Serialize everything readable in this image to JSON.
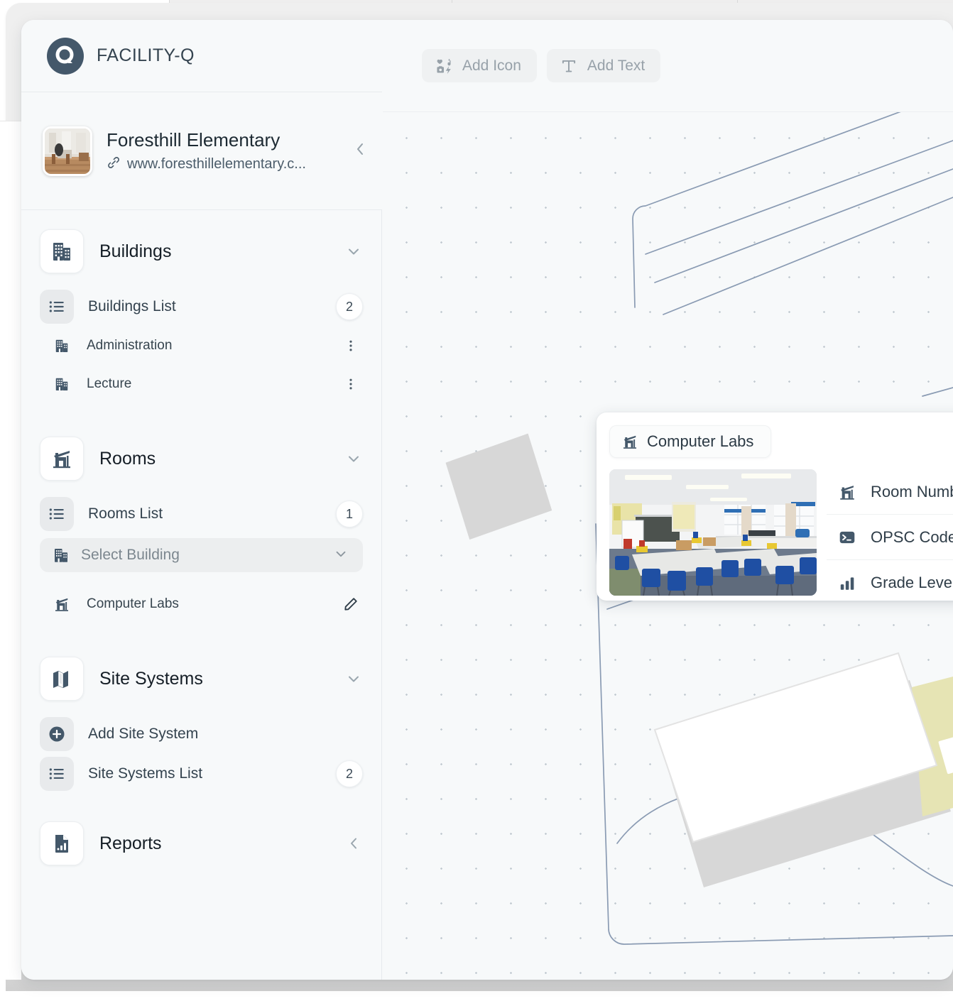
{
  "app": {
    "brand_name": "FACILITY-Q",
    "logo_icon": "circle-q-logo-icon",
    "accent_dark": "#44586a",
    "panel_bg": "#f7f9fa"
  },
  "site_card": {
    "thumbnail_icon": "site-interior-photo",
    "title": "Foresthill Elementary",
    "link_icon": "link-icon",
    "url": "www.foresthillelementary.c...",
    "collapse_icon": "chevron-left-icon"
  },
  "sidebar": {
    "groups": [
      {
        "id": "buildings",
        "label": "Buildings",
        "icon": "office-buildings-icon",
        "toggle_icon": "chevron-down-icon",
        "rows": [
          {
            "label": "Buildings List",
            "icon": "list-icon",
            "count": "2",
            "tile_filled": true
          },
          {
            "label": "Administration",
            "icon": "building-icon",
            "action_icon": "kebab-menu-icon"
          },
          {
            "label": "Lecture",
            "icon": "building-icon",
            "action_icon": "kebab-menu-icon"
          }
        ]
      },
      {
        "id": "rooms",
        "label": "Rooms",
        "icon": "house-icon",
        "toggle_icon": "chevron-down-icon",
        "rows": [
          {
            "label": "Rooms List",
            "icon": "list-icon",
            "count": "1",
            "tile_filled": true
          },
          {
            "label": "Computer Labs",
            "icon": "house-icon",
            "action_icon": "pencil-edit-icon"
          }
        ],
        "select": {
          "icon": "building-icon",
          "placeholder": "Select Building",
          "caret_icon": "chevron-down-icon"
        }
      },
      {
        "id": "site-systems",
        "label": "Site Systems",
        "icon": "map-icon",
        "toggle_icon": "chevron-down-icon",
        "rows": [
          {
            "label": "Add Site System",
            "icon": "plus-circle-icon",
            "tile_filled": true
          },
          {
            "label": "Site Systems List",
            "icon": "list-icon",
            "count": "2",
            "tile_filled": true
          }
        ]
      },
      {
        "id": "reports",
        "label": "Reports",
        "icon": "report-document-icon",
        "toggle_icon": "chevron-left-icon",
        "rows": []
      }
    ]
  },
  "toolbar": {
    "buttons": [
      {
        "label": "Add Icon",
        "icon": "icon-grid-icon"
      },
      {
        "label": "Add Text",
        "icon": "text-t-icon"
      }
    ]
  },
  "popup": {
    "chip_label": "Computer Labs",
    "chip_icon": "house-icon",
    "photo_icon": "classroom-photo",
    "fields": [
      {
        "label": "Room Number",
        "icon": "house-icon"
      },
      {
        "label": "OPSC Code",
        "icon": "terminal-icon"
      },
      {
        "label": "Grade Level",
        "icon": "bar-chart-icon"
      }
    ]
  },
  "canvas": {
    "grid_dot_color": "#c3cbd2",
    "map_line_color": "#8a9bb3",
    "building_fill": "#d7d7d7",
    "highlight_fill": "#e6e4b4"
  }
}
